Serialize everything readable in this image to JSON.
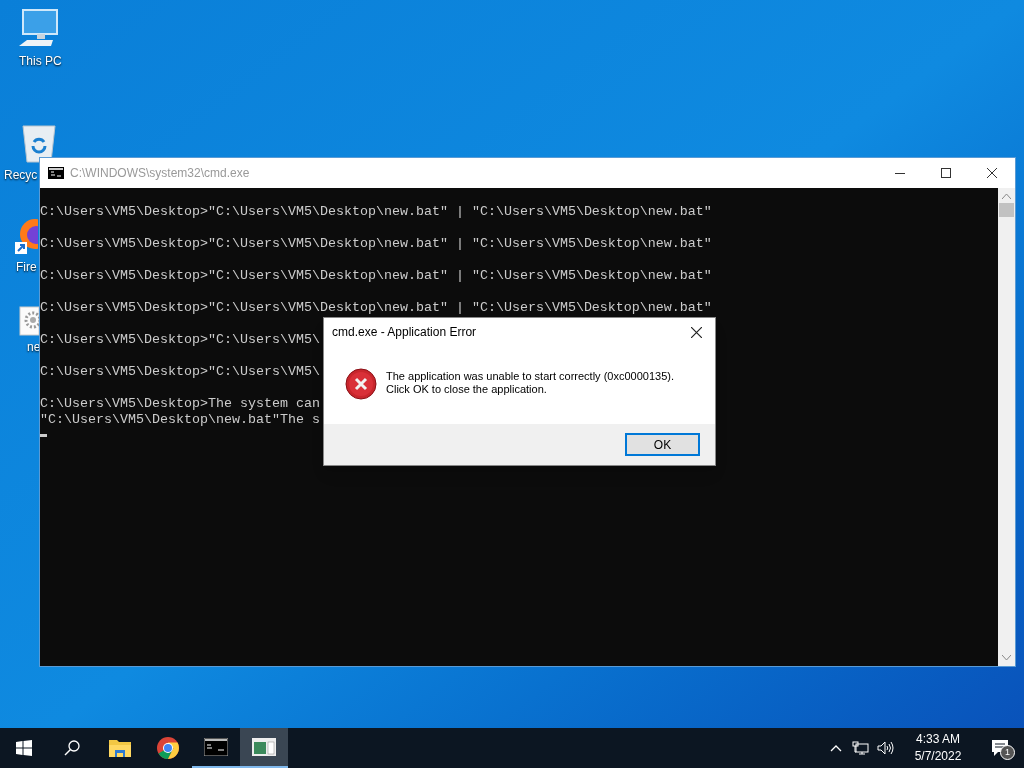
{
  "desktop_icons": [
    {
      "kind": "computer",
      "label": "This PC"
    },
    {
      "kind": "recycle-bin",
      "label": "Recyc"
    },
    {
      "kind": "firefox",
      "label": "Fire"
    },
    {
      "kind": "settings-file",
      "label": "ne"
    }
  ],
  "console_window": {
    "title": "C:\\WINDOWS\\system32\\cmd.exe",
    "output_blocks": [
      [
        "C:\\Users\\VM5\\Desktop>\"C:\\Users\\VM5\\Desktop\\new.bat\" | \"C:\\Users\\VM5\\Desktop\\new.bat\""
      ],
      [
        "C:\\Users\\VM5\\Desktop>\"C:\\Users\\VM5\\Desktop\\new.bat\" | \"C:\\Users\\VM5\\Desktop\\new.bat\""
      ],
      [
        "C:\\Users\\VM5\\Desktop>\"C:\\Users\\VM5\\Desktop\\new.bat\" | \"C:\\Users\\VM5\\Desktop\\new.bat\""
      ],
      [
        "C:\\Users\\VM5\\Desktop>\"C:\\Users\\VM5\\Desktop\\new.bat\" | \"C:\\Users\\VM5\\Desktop\\new.bat\""
      ],
      [
        "C:\\Users\\VM5\\Desktop>\"C:\\Users\\VM5\\"
      ],
      [
        "C:\\Users\\VM5\\Desktop>\"C:\\Users\\VM5\\"
      ],
      [
        "C:\\Users\\VM5\\Desktop>The system can",
        "\"C:\\Users\\VM5\\Desktop\\new.bat\"The s"
      ]
    ]
  },
  "error_dialog": {
    "title": "cmd.exe - Application Error",
    "message_lines": [
      "The application was unable to start correctly (0xc0000135).",
      "Click OK to close the application."
    ],
    "button": "OK"
  },
  "taskbar": {
    "items": [
      {
        "kind": "start",
        "running": false,
        "active": false
      },
      {
        "kind": "search",
        "running": false,
        "active": false
      },
      {
        "kind": "folder",
        "running": false,
        "active": false
      },
      {
        "kind": "chrome",
        "running": false,
        "active": false
      },
      {
        "kind": "console",
        "running": true,
        "active": false
      },
      {
        "kind": "window-app",
        "running": true,
        "active": true
      }
    ],
    "time": "4:33 AM",
    "date": "5/7/2022",
    "notification_count": "1"
  }
}
